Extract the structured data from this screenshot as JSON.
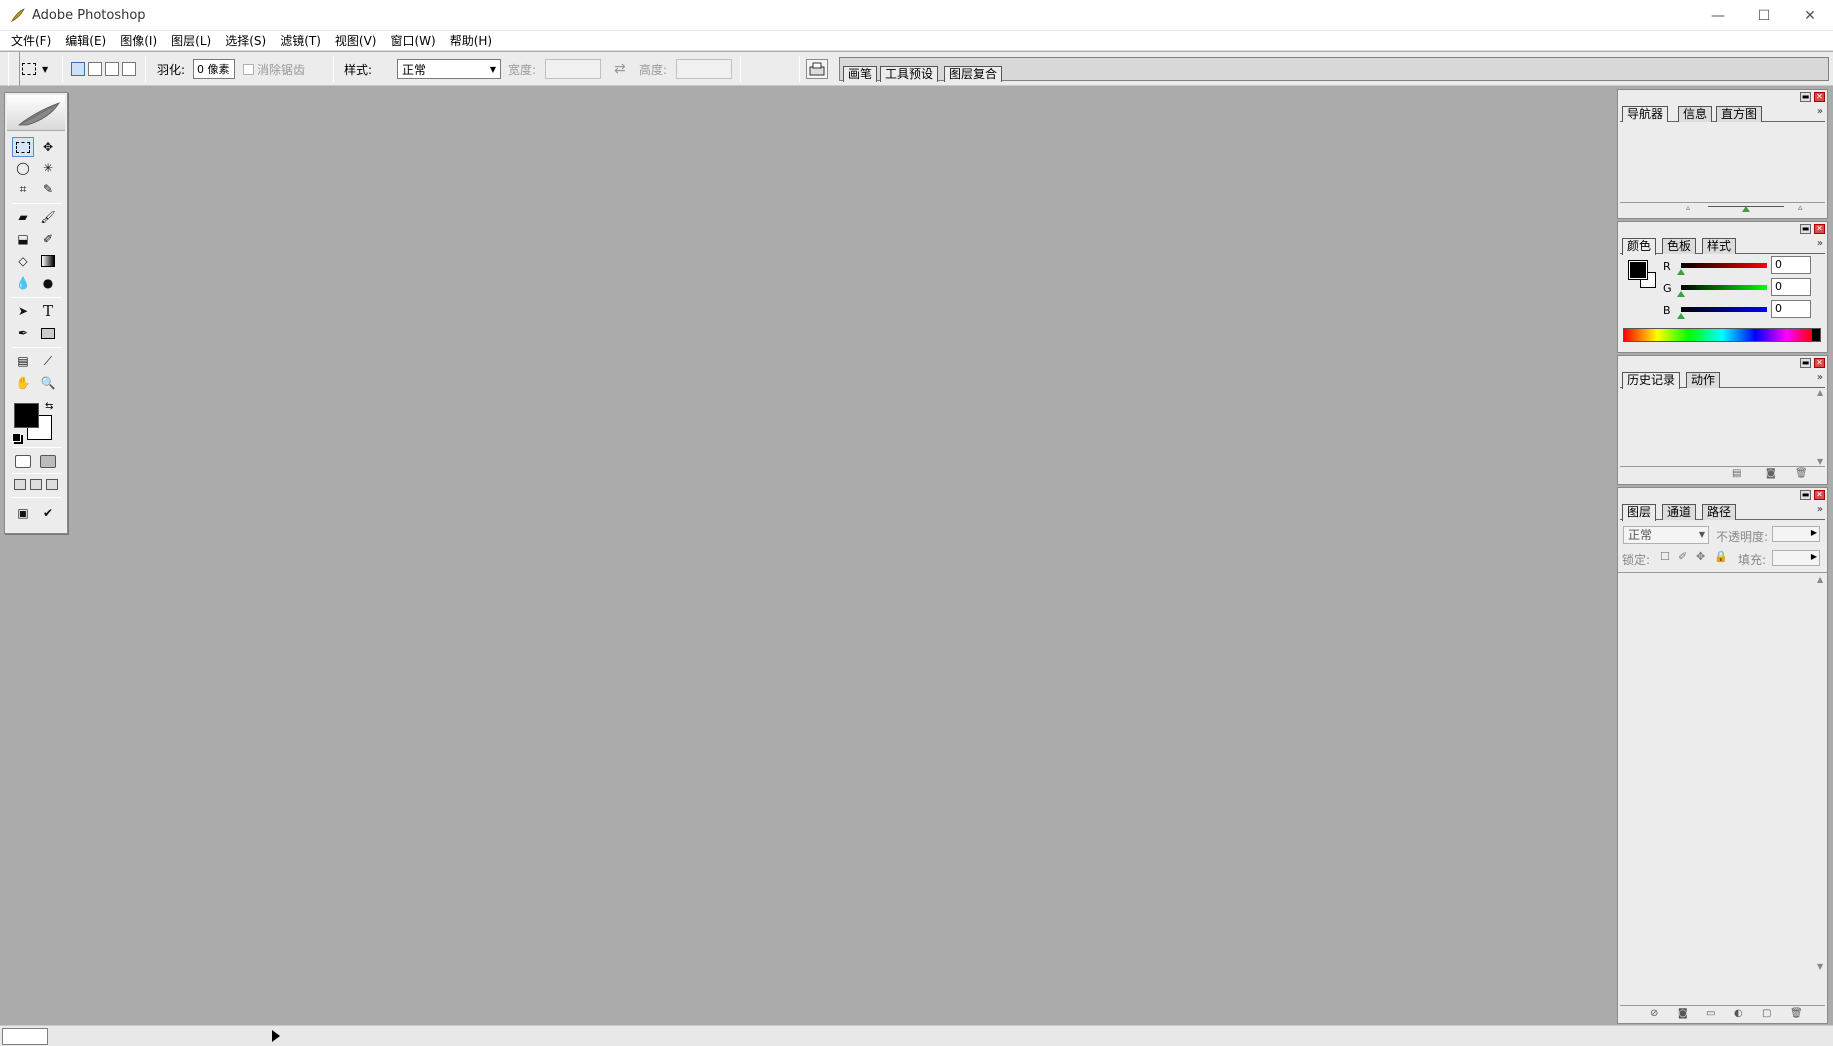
{
  "window": {
    "title": "Adobe Photoshop",
    "controls": {
      "minimize": "—",
      "maximize": "☐",
      "close": "✕"
    }
  },
  "menu": [
    "文件(F)",
    "编辑(E)",
    "图像(I)",
    "图层(L)",
    "选择(S)",
    "滤镜(T)",
    "视图(V)",
    "窗口(W)",
    "帮助(H)"
  ],
  "options": {
    "feather_label": "羽化:",
    "feather_value": "0 像素",
    "antialias_label": "消除锯齿",
    "style_label": "样式:",
    "style_value": "正常",
    "width_label": "宽度:",
    "height_label": "高度:",
    "swap_icon": "⇄"
  },
  "palette_well": {
    "tabs": [
      "画笔",
      "工具预设",
      "图层复合"
    ]
  },
  "navigator_panel": {
    "tabs": [
      "导航器",
      "信息",
      "直方图"
    ]
  },
  "color_panel": {
    "tabs": [
      "颜色",
      "色板",
      "样式"
    ],
    "channels": [
      {
        "label": "R",
        "value": "0",
        "color": "#d00000"
      },
      {
        "label": "G",
        "value": "0",
        "color": "#00b000"
      },
      {
        "label": "B",
        "value": "0",
        "color": "#0000c8"
      }
    ],
    "foreground": "#000000",
    "background": "#ffffff"
  },
  "history_panel": {
    "tabs": [
      "历史记录",
      "动作"
    ]
  },
  "layers_panel": {
    "tabs": [
      "图层",
      "通道",
      "路径"
    ],
    "blend_mode": "正常",
    "opacity_label": "不透明度:",
    "lock_label": "锁定:",
    "fill_label": "填充:"
  },
  "colors": {
    "workspace": "#ababab",
    "panel": "#ececec"
  }
}
